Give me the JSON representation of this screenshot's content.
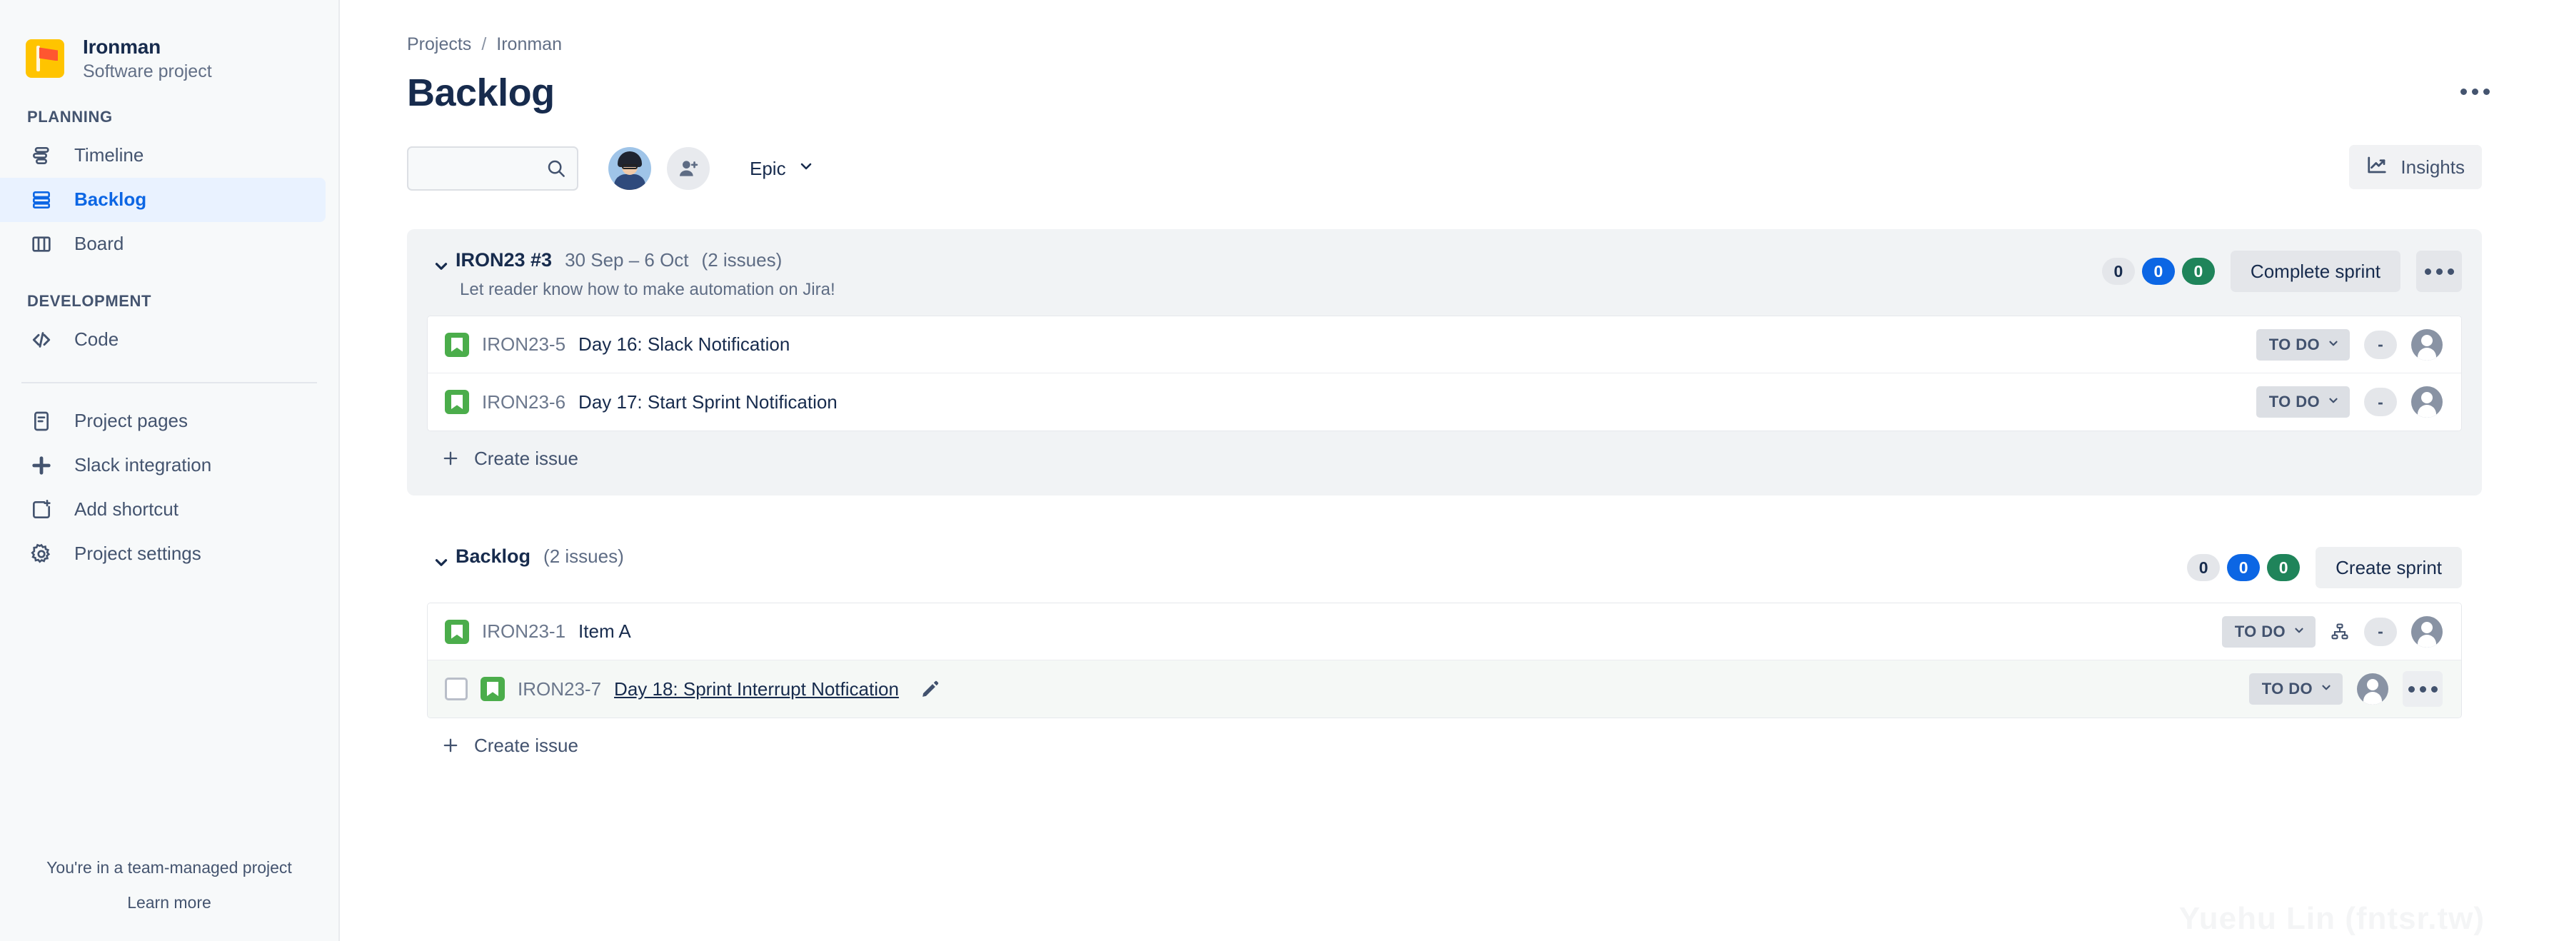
{
  "sidebar": {
    "project": {
      "name": "Ironman",
      "subtitle": "Software project",
      "icon": "flag-icon"
    },
    "sections": [
      {
        "title": "PLANNING",
        "items": [
          {
            "label": "Timeline",
            "icon": "timeline-icon",
            "active": false
          },
          {
            "label": "Backlog",
            "icon": "backlog-icon",
            "active": true
          },
          {
            "label": "Board",
            "icon": "board-icon",
            "active": false
          }
        ]
      },
      {
        "title": "DEVELOPMENT",
        "items": [
          {
            "label": "Code",
            "icon": "code-icon",
            "active": false
          }
        ]
      }
    ],
    "extra_items": [
      {
        "label": "Project pages",
        "icon": "pages-icon"
      },
      {
        "label": "Slack integration",
        "icon": "slack-icon"
      },
      {
        "label": "Add shortcut",
        "icon": "add-shortcut-icon"
      },
      {
        "label": "Project settings",
        "icon": "gear-icon"
      }
    ],
    "footer": {
      "line1": "You're in a team-managed project",
      "line2": "Learn more"
    }
  },
  "header": {
    "breadcrumb": {
      "root": "Projects",
      "separator": "/",
      "current": "Ironman"
    },
    "title": "Backlog",
    "more_icon": "more-horizontal-icon"
  },
  "toolbar": {
    "search": {
      "value": "",
      "placeholder": "",
      "icon": "search-icon"
    },
    "avatar": {
      "name": "avatar",
      "icon": "user-avatar"
    },
    "add_people": {
      "label": "",
      "icon": "add-person-icon"
    },
    "epic_filter": {
      "label": "Epic",
      "icon": "chevron-down-icon"
    },
    "insights": {
      "label": "Insights",
      "icon": "insights-chart-icon"
    }
  },
  "sprint": {
    "name": "IRON23 #3",
    "dates": "30 Sep – 6 Oct",
    "issue_count": "(2 issues)",
    "goal": "Let reader know how to make automation on Jira!",
    "badges": [
      {
        "value": "0",
        "color": "#e4e6ea",
        "style": "gray"
      },
      {
        "value": "0",
        "color": "#0c66e4",
        "style": "blue"
      },
      {
        "value": "0",
        "color": "#1f845a",
        "style": "green"
      }
    ],
    "action_label": "Complete sprint",
    "more_icon": "more-horizontal-icon",
    "create_issue_label": "Create issue",
    "issues": [
      {
        "key": "IRON23-5",
        "summary": "Day 16: Slack Notification",
        "type": "story",
        "status": "TO DO",
        "points": "-",
        "has_checkbox": false,
        "has_child_icon": false,
        "has_more": false,
        "editing": false
      },
      {
        "key": "IRON23-6",
        "summary": "Day 17: Start Sprint Notification",
        "type": "story",
        "status": "TO DO",
        "points": "-",
        "has_checkbox": false,
        "has_child_icon": false,
        "has_more": false,
        "editing": false
      }
    ]
  },
  "backlog": {
    "name": "Backlog",
    "issue_count": "(2 issues)",
    "badges": [
      {
        "value": "0",
        "color": "#e4e6ea",
        "style": "gray"
      },
      {
        "value": "0",
        "color": "#0c66e4",
        "style": "blue"
      },
      {
        "value": "0",
        "color": "#1f845a",
        "style": "green"
      }
    ],
    "action_label": "Create sprint",
    "create_issue_label": "Create issue",
    "issues": [
      {
        "key": "IRON23-1",
        "summary": "Item A",
        "type": "story",
        "status": "TO DO",
        "points": "-",
        "has_checkbox": false,
        "has_child_icon": true,
        "has_more": false,
        "editing": false
      },
      {
        "key": "IRON23-7",
        "summary": "Day 18: Sprint Interrupt Notfication",
        "type": "story",
        "status": "TO DO",
        "points": null,
        "has_checkbox": true,
        "has_child_icon": false,
        "has_more": true,
        "editing": true
      }
    ]
  },
  "watermark": "Yuehu Lin (fntsr.tw)"
}
